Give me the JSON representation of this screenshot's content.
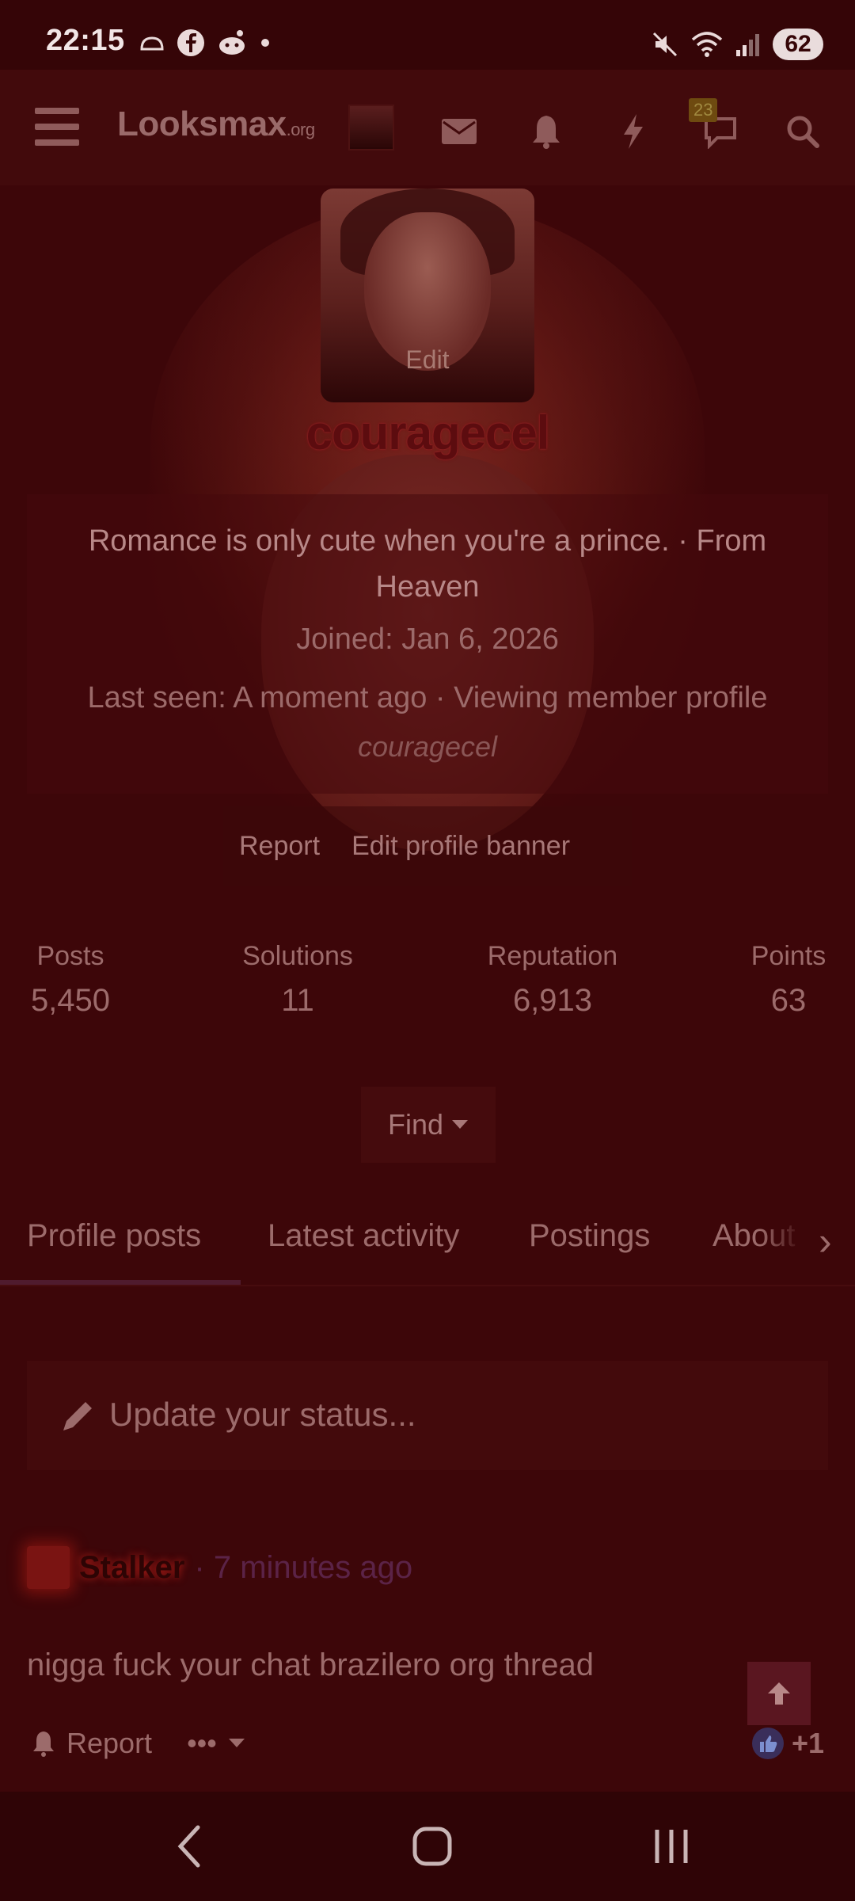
{
  "status_bar": {
    "time": "22:15",
    "battery": "62",
    "left_icons": [
      "cloud-icon",
      "facebook-icon",
      "reddit-icon",
      "dot-icon"
    ],
    "right_icons": [
      "mute-icon",
      "wifi-icon",
      "signal-icon"
    ]
  },
  "nav": {
    "logo_text": "Looksmax",
    "logo_suffix": ".org",
    "conversations_badge": "23",
    "icons": [
      "menu-icon",
      "avatar",
      "mail-icon",
      "bell-icon",
      "bolt-icon",
      "chat-icon",
      "search-icon"
    ]
  },
  "profile": {
    "avatar_edit_label": "Edit",
    "username": "couragecel",
    "bio": "Romance is only cute when you're a prince. · From Heaven",
    "joined": "Joined: Jan 6, 2026",
    "last_seen": "Last seen: A moment ago · Viewing member profile",
    "last_seen_user": "couragecel",
    "actions": {
      "report": "Report",
      "edit_banner": "Edit profile banner"
    }
  },
  "stats": [
    {
      "label": "Posts",
      "value": "5,450"
    },
    {
      "label": "Solutions",
      "value": "11"
    },
    {
      "label": "Reputation",
      "value": "6,913"
    },
    {
      "label": "Points",
      "value": "63"
    }
  ],
  "find_label": "Find",
  "tabs": [
    "Profile posts",
    "Latest activity",
    "Postings",
    "About"
  ],
  "status_placeholder": "Update your status...",
  "post": {
    "author": "Stalker",
    "time": "· 7 minutes ago",
    "text": "nigga fuck your chat brazilero org thread",
    "report_label": "Report",
    "more_label": "•••",
    "reaction_count": "+1"
  },
  "colors": {
    "background": "#3d0609",
    "navbar": "#420a0c",
    "username_glow": "#a3262a"
  }
}
